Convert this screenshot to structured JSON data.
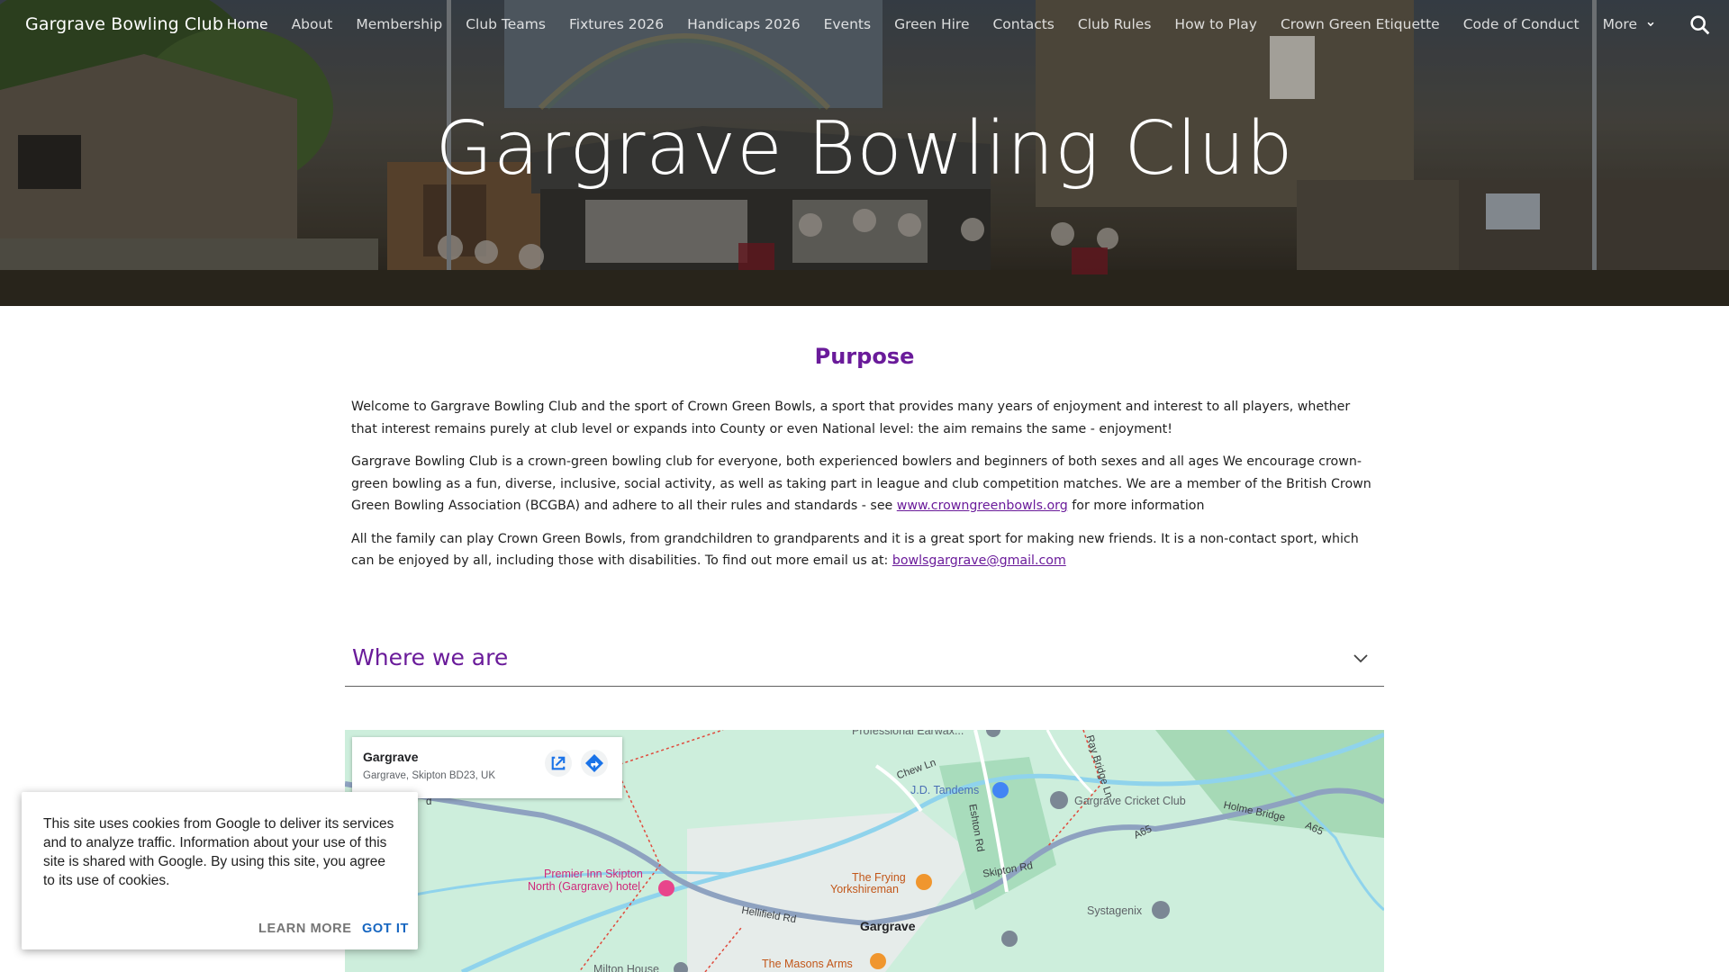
{
  "site": {
    "name": "Gargrave Bowling Club"
  },
  "nav": {
    "items": [
      {
        "label": "Home",
        "active": true
      },
      {
        "label": "About"
      },
      {
        "label": "Membership"
      },
      {
        "label": "Club Teams"
      },
      {
        "label": "Fixtures 2026"
      },
      {
        "label": "Handicaps 2026"
      },
      {
        "label": "Events"
      },
      {
        "label": "Green Hire"
      },
      {
        "label": "Contacts"
      },
      {
        "label": "Club Rules"
      },
      {
        "label": "How to Play"
      },
      {
        "label": "Crown Green Etiquette"
      },
      {
        "label": "Code of Conduct"
      }
    ],
    "more_label": "More",
    "more_icon": "chevron-down-icon",
    "search_icon": "search-icon"
  },
  "hero": {
    "title": "Gargrave Bowling Club"
  },
  "purpose": {
    "heading": "Purpose",
    "p1": "Welcome to Gargrave Bowling Club and the sport of Crown Green Bowls, a sport that provides many years of enjoyment and interest to all players, whether that interest remains purely at club level or expands into County or even National level: the aim remains the same - enjoyment!",
    "p2_a": "Gargrave Bowling Club is a crown-green bowling club for everyone, both experienced bowlers and beginners of both sexes and all ages  We encourage crown-green bowling  as a fun, diverse, inclusive, social activity, as well as taking part in league and club competition matches. We are a member of the British Crown Green Bowling Association (BCGBA) and adhere to all their rules and standards - see ",
    "p2_link": "www.crowngreenbowls.org",
    "p2_b": " for more information",
    "p3_a": "All the family can play Crown Green Bowls, from grandchildren to grandparents and it is a great sport for making new friends. It is a non-contact sport, which can be enjoyed by all, including those with disabilities. To find out more email us at: ",
    "p3_link": "bowlsgargrave@gmail.com"
  },
  "where": {
    "heading": "Where we are",
    "toggle_icon": "chevron-down-icon"
  },
  "map": {
    "card": {
      "name": "Gargrave",
      "address": "Gargrave, Skipton BD23, UK",
      "open_icon": "open-in-new-icon",
      "directions_icon": "directions-icon"
    },
    "labels": {
      "earwax": "Professional Earwax...",
      "chew_ln": "Chew Ln",
      "ray_bridge_ln": "Ray Bridge Ln",
      "jd_tandems": "J.D. Tandems",
      "cricket_club": "Gargrave Cricket Club",
      "holme_bridge": "Holme Bridge",
      "a65_east": "A65",
      "a65_mid": "A65",
      "eshton_rd": "Eshton Rd",
      "skipton_rd": "Skipton Rd",
      "premier_inn_1": "Premier Inn Skipton",
      "premier_inn_2": "North (Gargrave) hotel",
      "frying_1": "The Frying",
      "frying_2": "Yorkshireman",
      "systagenix": "Systagenix",
      "hellifield_rd": "Hellifield Rd",
      "town": "Gargrave",
      "masons_arms": "The Masons Arms",
      "milton_house": "Milton House",
      "rd_left": "d"
    }
  },
  "cookie": {
    "message": "This site uses cookies from Google to deliver its services and to analyze traffic. Information about your use of this site is shared with Google. By using this site, you agree to its use of cookies.",
    "learn_more": "LEARN MORE",
    "got_it": "GOT IT"
  },
  "colors": {
    "accent": "#6a1b9a",
    "link": "#6a1b9a",
    "cookie_action": "#1565c0",
    "map_water": "#8fd3ec",
    "map_land": "#c9ead9"
  }
}
